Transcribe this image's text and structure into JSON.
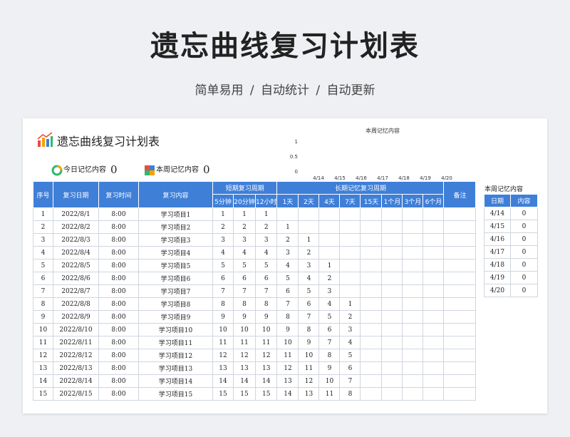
{
  "hero": {
    "title": "遗忘曲线复习计划表",
    "subtitle": "简单易用  /  自动统计  /  自动更新"
  },
  "sheet": {
    "title": "遗忘曲线复习计划表",
    "today_label": "今日记忆内容",
    "today_value": "0",
    "week_label": "本周记忆内容",
    "week_value": "0"
  },
  "chart_data": {
    "type": "bar",
    "title": "本周记忆内容",
    "categories": [
      "4/14",
      "4/15",
      "4/16",
      "4/17",
      "4/18",
      "4/19",
      "4/20"
    ],
    "values": [
      0,
      0,
      0,
      0,
      0,
      0,
      0
    ],
    "y_ticks": [
      "1",
      "0.5",
      "0"
    ],
    "ylim": [
      0,
      1
    ],
    "grid": false,
    "legend": "none"
  },
  "table": {
    "headers": {
      "seq": "序号",
      "date": "复习日期",
      "time": "复习时间",
      "content": "复习内容",
      "short_group": "短期复习周期",
      "long_group": "长期记忆复习周期",
      "note": "备注",
      "short": [
        "5分钟",
        "20分钟",
        "12小时"
      ],
      "long": [
        "1天",
        "2天",
        "4天",
        "7天",
        "15天",
        "1个月",
        "3个月",
        "6个月"
      ]
    },
    "rows": [
      {
        "seq": "1",
        "date": "2022/8/1",
        "time": "8:00",
        "content": "学习项目1",
        "short": [
          "1",
          "1",
          "1"
        ],
        "long": [
          "",
          "",
          "",
          "",
          "",
          "",
          "",
          ""
        ],
        "note": ""
      },
      {
        "seq": "2",
        "date": "2022/8/2",
        "time": "8:00",
        "content": "学习项目2",
        "short": [
          "2",
          "2",
          "2"
        ],
        "long": [
          "1",
          "",
          "",
          "",
          "",
          "",
          "",
          ""
        ],
        "note": ""
      },
      {
        "seq": "3",
        "date": "2022/8/3",
        "time": "8:00",
        "content": "学习项目3",
        "short": [
          "3",
          "3",
          "3"
        ],
        "long": [
          "2",
          "1",
          "",
          "",
          "",
          "",
          "",
          ""
        ],
        "note": ""
      },
      {
        "seq": "4",
        "date": "2022/8/4",
        "time": "8:00",
        "content": "学习项目4",
        "short": [
          "4",
          "4",
          "4"
        ],
        "long": [
          "3",
          "2",
          "",
          "",
          "",
          "",
          "",
          ""
        ],
        "note": ""
      },
      {
        "seq": "5",
        "date": "2022/8/5",
        "time": "8:00",
        "content": "学习项目5",
        "short": [
          "5",
          "5",
          "5"
        ],
        "long": [
          "4",
          "3",
          "1",
          "",
          "",
          "",
          "",
          ""
        ],
        "note": ""
      },
      {
        "seq": "6",
        "date": "2022/8/6",
        "time": "8:00",
        "content": "学习项目6",
        "short": [
          "6",
          "6",
          "6"
        ],
        "long": [
          "5",
          "4",
          "2",
          "",
          "",
          "",
          "",
          ""
        ],
        "note": ""
      },
      {
        "seq": "7",
        "date": "2022/8/7",
        "time": "8:00",
        "content": "学习项目7",
        "short": [
          "7",
          "7",
          "7"
        ],
        "long": [
          "6",
          "5",
          "3",
          "",
          "",
          "",
          "",
          ""
        ],
        "note": ""
      },
      {
        "seq": "8",
        "date": "2022/8/8",
        "time": "8:00",
        "content": "学习项目8",
        "short": [
          "8",
          "8",
          "8"
        ],
        "long": [
          "7",
          "6",
          "4",
          "1",
          "",
          "",
          "",
          ""
        ],
        "note": ""
      },
      {
        "seq": "9",
        "date": "2022/8/9",
        "time": "8:00",
        "content": "学习项目9",
        "short": [
          "9",
          "9",
          "9"
        ],
        "long": [
          "8",
          "7",
          "5",
          "2",
          "",
          "",
          "",
          ""
        ],
        "note": ""
      },
      {
        "seq": "10",
        "date": "2022/8/10",
        "time": "8:00",
        "content": "学习项目10",
        "short": [
          "10",
          "10",
          "10"
        ],
        "long": [
          "9",
          "8",
          "6",
          "3",
          "",
          "",
          "",
          ""
        ],
        "note": ""
      },
      {
        "seq": "11",
        "date": "2022/8/11",
        "time": "8:00",
        "content": "学习项目11",
        "short": [
          "11",
          "11",
          "11"
        ],
        "long": [
          "10",
          "9",
          "7",
          "4",
          "",
          "",
          "",
          ""
        ],
        "note": ""
      },
      {
        "seq": "12",
        "date": "2022/8/12",
        "time": "8:00",
        "content": "学习项目12",
        "short": [
          "12",
          "12",
          "12"
        ],
        "long": [
          "11",
          "10",
          "8",
          "5",
          "",
          "",
          "",
          ""
        ],
        "note": ""
      },
      {
        "seq": "13",
        "date": "2022/8/13",
        "time": "8:00",
        "content": "学习项目13",
        "short": [
          "13",
          "13",
          "13"
        ],
        "long": [
          "12",
          "11",
          "9",
          "6",
          "",
          "",
          "",
          ""
        ],
        "note": ""
      },
      {
        "seq": "14",
        "date": "2022/8/14",
        "time": "8:00",
        "content": "学习项目14",
        "short": [
          "14",
          "14",
          "14"
        ],
        "long": [
          "13",
          "12",
          "10",
          "7",
          "",
          "",
          "",
          ""
        ],
        "note": ""
      },
      {
        "seq": "15",
        "date": "2022/8/15",
        "time": "8:00",
        "content": "学习项目15",
        "short": [
          "15",
          "15",
          "15"
        ],
        "long": [
          "14",
          "13",
          "11",
          "8",
          "",
          "",
          "",
          ""
        ],
        "note": ""
      }
    ]
  },
  "week_table": {
    "title": "本周记忆内容",
    "headers": [
      "日期",
      "内容"
    ],
    "rows": [
      [
        "4/14",
        "0"
      ],
      [
        "4/15",
        "0"
      ],
      [
        "4/16",
        "0"
      ],
      [
        "4/17",
        "0"
      ],
      [
        "4/18",
        "0"
      ],
      [
        "4/19",
        "0"
      ],
      [
        "4/20",
        "0"
      ]
    ]
  },
  "colors": {
    "header_blue": "#3f7fd8",
    "grid": "#cfd6df",
    "page_bg": "#eef0f3"
  }
}
